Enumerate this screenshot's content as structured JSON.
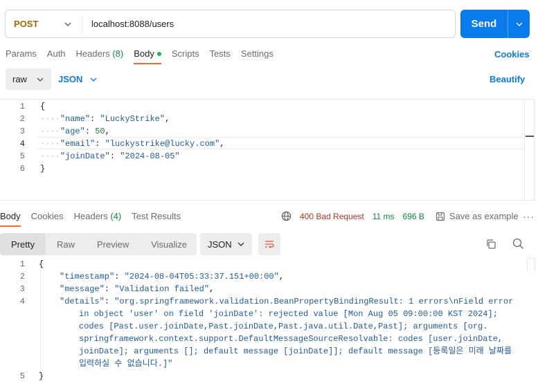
{
  "request": {
    "method": "POST",
    "url": "localhost:8088/users",
    "send_label": "Send"
  },
  "request_tabs": [
    {
      "label": "Params"
    },
    {
      "label": "Auth"
    },
    {
      "label": "Headers",
      "count": "(8)"
    },
    {
      "label": "Body",
      "active": true
    },
    {
      "label": "Scripts"
    },
    {
      "label": "Tests"
    },
    {
      "label": "Settings"
    }
  ],
  "cookies_label": "Cookies",
  "body_mode": "raw",
  "body_format": "JSON",
  "beautify_label": "Beautify",
  "request_body": {
    "line_numbers": [
      "1",
      "2",
      "3",
      "4",
      "5",
      "6"
    ],
    "open_brace": "{",
    "close_brace": "}",
    "fields": [
      {
        "key": "\"name\"",
        "value": "\"LuckyStrike\"",
        "type": "string",
        "trail": ","
      },
      {
        "key": "\"age\"",
        "value": "50",
        "type": "number",
        "trail": ","
      },
      {
        "key": "\"email\"",
        "value": "\"luckystrike@lucky.com\"",
        "type": "string",
        "trail": ","
      },
      {
        "key": "\"joinDate\"",
        "value": "\"2024-08-05\"",
        "type": "string",
        "trail": ""
      }
    ]
  },
  "response_tabs": [
    {
      "label": "Body",
      "active": true
    },
    {
      "label": "Cookies"
    },
    {
      "label": "Headers",
      "count": "(4)"
    },
    {
      "label": "Test Results"
    }
  ],
  "response_status": {
    "status": "400 Bad Request",
    "time": "11 ms",
    "size": "696 B",
    "save_label": "Save as example",
    "more": "···"
  },
  "view_tabs": [
    "Pretty",
    "Raw",
    "Preview",
    "Visualize"
  ],
  "response_format": "JSON",
  "response_body": {
    "line_numbers": [
      "1",
      "2",
      "3",
      "4",
      "5"
    ],
    "open_brace": "{",
    "close_brace": "}",
    "timestamp_key": "\"timestamp\"",
    "timestamp_value": "\"2024-08-04T05:33:37.151+00:00\"",
    "message_key": "\"message\"",
    "message_value": "\"Validation failed\"",
    "details_key": "\"details\"",
    "details_lines": [
      "\"org.springframework.validation.BeanPropertyBindingResult: 1 errors\\nField error",
      "in object 'user' on field 'joinDate': rejected value [Mon Aug 05 09:00:00 KST 2024];",
      "codes [Past.user.joinDate,Past.joinDate,Past.java.util.Date,Past]; arguments [org.",
      "springframework.context.support.DefaultMessageSourceResolvable: codes [user.joinDate,",
      "joinDate]; arguments []; default message [joinDate]]; default message [등록일은 미래 날짜를",
      "입력하실 수 없습니다.]\""
    ]
  },
  "colors": {
    "accent": "#097bed",
    "method": "#a56800",
    "error": "#b5321f",
    "success": "#0a8a3e",
    "active_tab": "#f26b3a"
  }
}
